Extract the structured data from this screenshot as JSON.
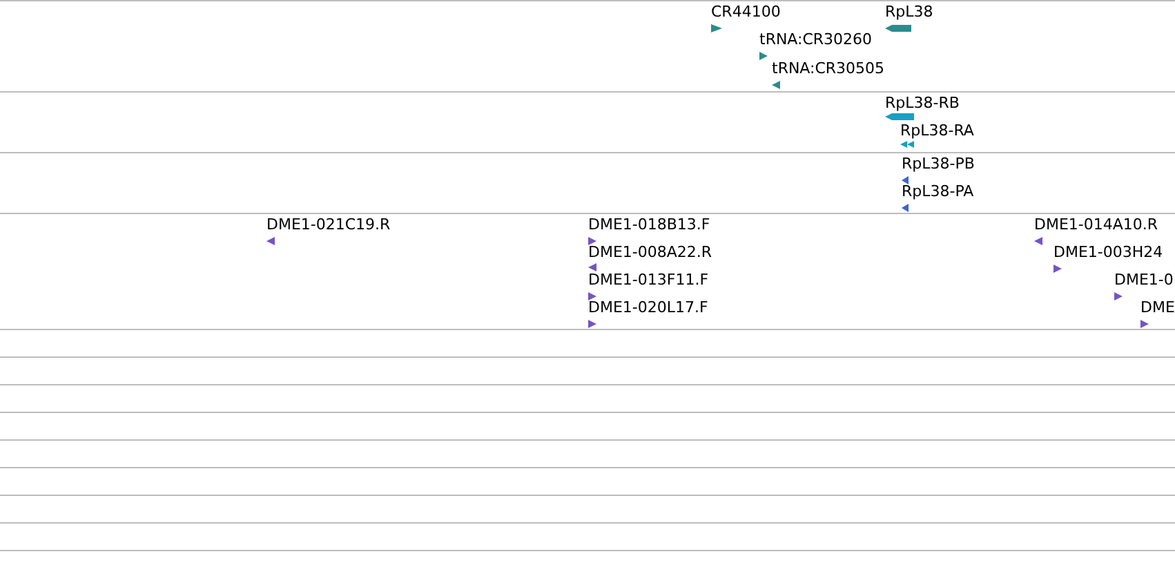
{
  "tracks": [
    {
      "color": "#2a8c8c",
      "features": [
        {
          "label": "CR44100",
          "forward": true,
          "kind": "marker"
        },
        {
          "label": "RpL38",
          "forward": false,
          "kind": "block"
        },
        {
          "label": "tRNA:CR30260",
          "forward": true,
          "kind": "marker"
        },
        {
          "label": "tRNA:CR30505",
          "forward": false,
          "kind": "marker"
        }
      ]
    },
    {
      "color": "#18a0c4",
      "features": [
        {
          "label": "RpL38-RB",
          "forward": false,
          "kind": "block"
        },
        {
          "label": "RpL38-RA",
          "forward": false,
          "kind": "double"
        }
      ]
    },
    {
      "color": "#3a66d0",
      "features": [
        {
          "label": "RpL38-PB",
          "forward": false,
          "kind": "marker"
        },
        {
          "label": "RpL38-PA",
          "forward": false,
          "kind": "marker"
        }
      ]
    },
    {
      "color": "#7455c4",
      "features": [
        {
          "label": "DME1-021C19.R",
          "forward": false,
          "kind": "marker"
        },
        {
          "label": "DME1-018B13.F",
          "forward": true,
          "kind": "marker"
        },
        {
          "label": "DME1-008A22.R",
          "forward": false,
          "kind": "marker"
        },
        {
          "label": "DME1-013F11.F",
          "forward": true,
          "kind": "marker"
        },
        {
          "label": "DME1-020L17.F",
          "forward": true,
          "kind": "marker"
        },
        {
          "label": "DME1-014A10.R",
          "forward": false,
          "kind": "marker"
        },
        {
          "label": "DME1-003H24",
          "forward": true,
          "kind": "marker"
        },
        {
          "label": "DME1-0",
          "forward": true,
          "kind": "marker"
        },
        {
          "label": "DME",
          "forward": true,
          "kind": "marker"
        }
      ]
    }
  ]
}
